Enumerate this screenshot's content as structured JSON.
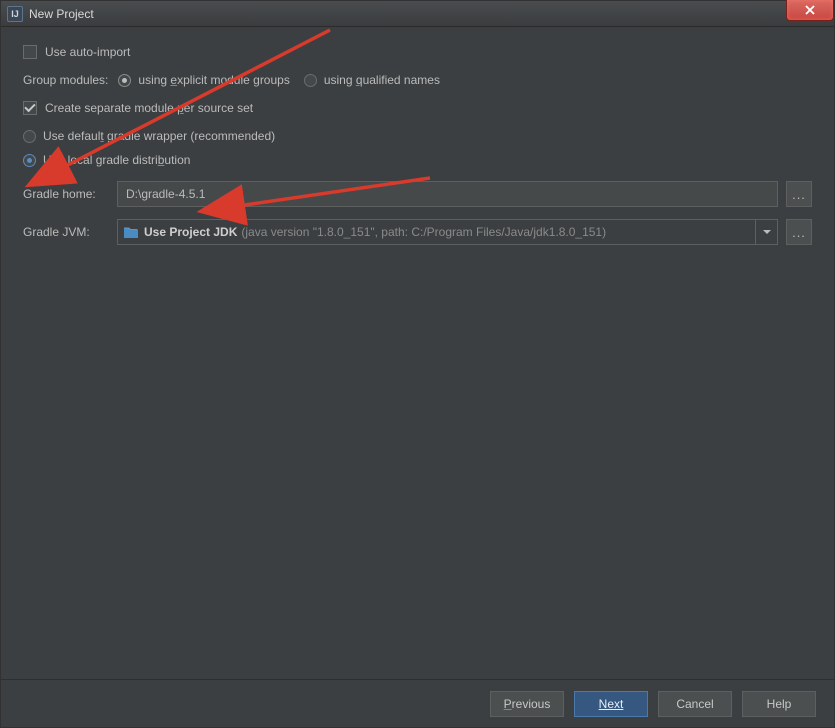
{
  "title": "New Project",
  "options": {
    "auto_import_label": "Use auto-import",
    "auto_import_checked": false,
    "group_modules_label": "Group modules:",
    "group_explicit_label": "using explicit module groups",
    "group_qualified_label": "using qualified names",
    "group_selected": "explicit",
    "create_separate_label": "Create separate module per source set",
    "create_separate_checked": true,
    "wrapper_default_label": "Use default gradle wrapper (recommended)",
    "wrapper_local_label": "Use local gradle distribution",
    "wrapper_selected": "local"
  },
  "gradle_home": {
    "label": "Gradle home:",
    "value": "D:\\gradle-4.5.1"
  },
  "gradle_jvm": {
    "label": "Gradle JVM:",
    "selected_bold": "Use Project JDK",
    "selected_sub": "(java version \"1.8.0_151\", path: C:/Program Files/Java/jdk1.8.0_151)"
  },
  "footer": {
    "previous": "Previous",
    "next": "Next",
    "cancel": "Cancel",
    "help": "Help"
  },
  "browse_label": "..."
}
